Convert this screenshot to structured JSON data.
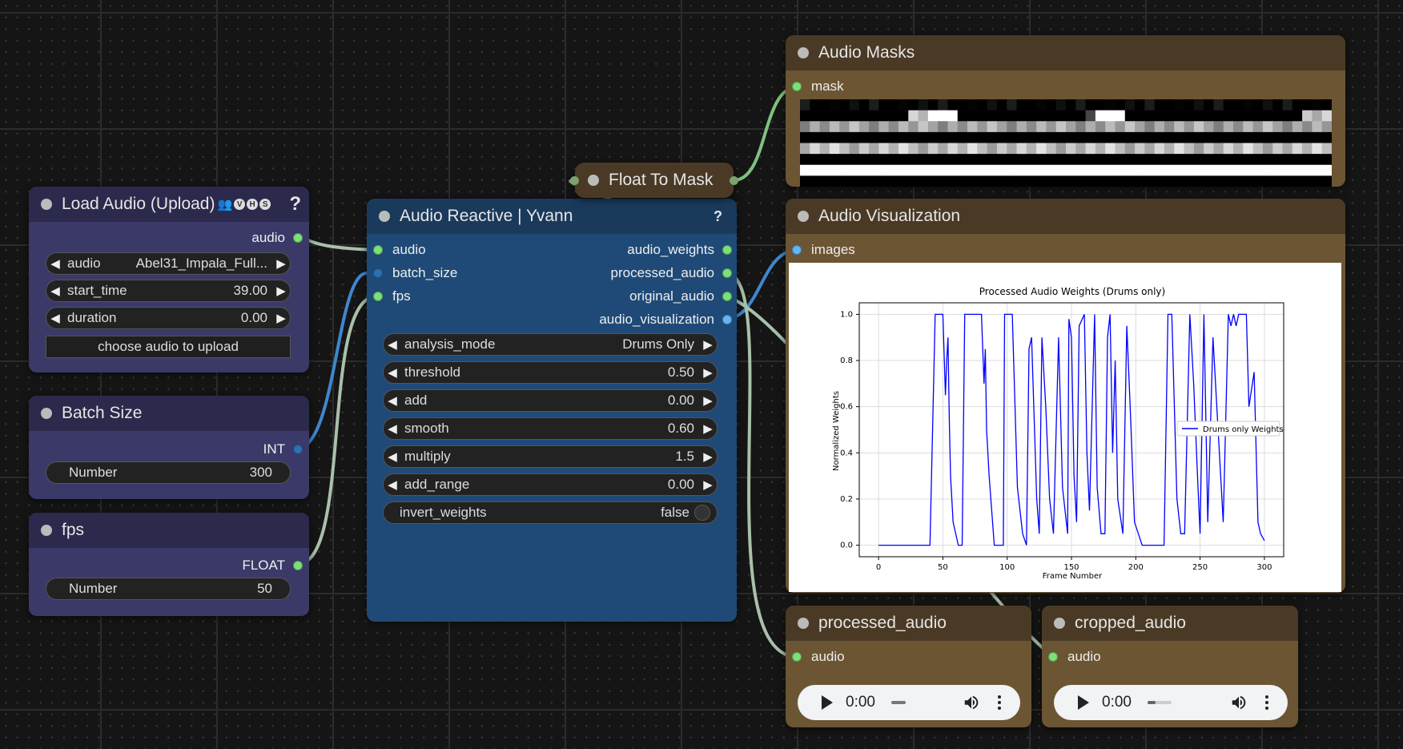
{
  "nodes": {
    "load_audio": {
      "title": "Load Audio (Upload)",
      "badges": [
        "V",
        "H",
        "S"
      ],
      "help": "?",
      "output": "audio",
      "widgets": {
        "audio": {
          "label": "audio",
          "value": "Abel31_Impala_Full..."
        },
        "start_time": {
          "label": "start_time",
          "value": "39.00"
        },
        "duration": {
          "label": "duration",
          "value": "0.00"
        }
      },
      "upload_button": "choose audio to upload"
    },
    "batch_size": {
      "title": "Batch Size",
      "output": "INT",
      "widget_label": "Number",
      "widget_value": "300"
    },
    "fps": {
      "title": "fps",
      "output": "FLOAT",
      "widget_label": "Number",
      "widget_value": "50"
    },
    "float_to_mask": {
      "title": "Float To Mask"
    },
    "audio_reactive": {
      "title": "Audio Reactive | Yvann",
      "help": "?",
      "inputs": [
        "audio",
        "batch_size",
        "fps"
      ],
      "outputs": [
        "audio_weights",
        "processed_audio",
        "original_audio",
        "audio_visualization"
      ],
      "widgets": [
        {
          "label": "analysis_mode",
          "value": "Drums Only"
        },
        {
          "label": "threshold",
          "value": "0.50"
        },
        {
          "label": "add",
          "value": "0.00"
        },
        {
          "label": "smooth",
          "value": "0.60"
        },
        {
          "label": "multiply",
          "value": "1.5"
        },
        {
          "label": "add_range",
          "value": "0.00"
        }
      ],
      "toggle": {
        "label": "invert_weights",
        "value": "false"
      }
    },
    "audio_masks": {
      "title": "Audio Masks",
      "input": "mask"
    },
    "audio_visualization": {
      "title": "Audio Visualization",
      "input": "images"
    },
    "processed_audio": {
      "title": "processed_audio",
      "input": "audio",
      "time": "0:00"
    },
    "cropped_audio": {
      "title": "cropped_audio",
      "input": "audio",
      "time": "0:00"
    }
  },
  "colors": {
    "purple_title": "#2b2a4c",
    "purple_body": "#3a3968",
    "blue_title": "#1a3a5c",
    "blue_body": "#1f4a77",
    "brown_title": "#4a3a25",
    "brown_body": "#6b5533",
    "link_gray": "#a9c0aa",
    "link_blue": "#3f87cf",
    "link_green": "#80c080",
    "plot_line": "#0000ff"
  },
  "mask_rows": [
    "111111111111111111111111111111111111111111111111111110",
    "000000000008899900000000000005999000000000000000000888",
    "777777777777777777777777777777777777777777777777777777",
    "000000000000000000000000000000000000000000000000000000",
    "888888888888888888888888888888888888888888888888888888",
    "000000000000000000000000000000000000000000000000000000",
    "999999999999999999999999999999999999999999999999999999",
    "000000000000000000000000000000000000000000000000000000"
  ],
  "chart_data": {
    "type": "line",
    "title": "Processed Audio Weights (Drums only)",
    "xlabel": "Frame Number",
    "ylabel": "Normalized Weights",
    "xlim": [
      -15,
      315
    ],
    "ylim": [
      -0.05,
      1.05
    ],
    "x_ticks": [
      0,
      50,
      100,
      150,
      200,
      250,
      300
    ],
    "y_ticks": [
      "0.0",
      "0.2",
      "0.4",
      "0.6",
      "0.8",
      "1.0"
    ],
    "grid": true,
    "legend_position": "right",
    "series": [
      {
        "name": "Drums only Weights",
        "x": [
          0,
          40,
          44,
          50,
          52,
          53,
          54,
          55,
          56,
          58,
          62,
          65,
          67,
          70,
          75,
          80,
          82,
          83,
          84,
          86,
          90,
          97,
          98,
          100,
          102,
          104,
          108,
          112,
          115,
          117,
          119,
          121,
          123,
          125,
          127,
          130,
          133,
          136,
          140,
          143,
          147,
          148,
          150,
          152,
          154,
          156,
          160,
          162,
          164,
          168,
          170,
          173,
          176,
          178,
          180,
          182,
          184,
          186,
          190,
          193,
          196,
          199,
          202,
          205,
          210,
          222,
          225,
          228,
          232,
          235,
          238,
          242,
          245,
          248,
          250,
          253,
          256,
          260,
          264,
          268,
          272,
          274,
          276,
          278,
          280,
          283,
          286,
          288,
          292,
          295,
          297,
          300
        ],
        "y": [
          0,
          0,
          1,
          1,
          0.65,
          0.8,
          0.9,
          0.55,
          0.3,
          0.1,
          0,
          0,
          1,
          1,
          1,
          1,
          0.7,
          0.85,
          0.5,
          0.3,
          0,
          0,
          1,
          1,
          1,
          1,
          0.25,
          0.05,
          0,
          0.85,
          0.9,
          0.55,
          0.2,
          0.05,
          0.9,
          0.6,
          0.2,
          0.05,
          0.9,
          0.25,
          0.05,
          0.98,
          0.9,
          0.3,
          0.1,
          0.95,
          1,
          0.4,
          0.15,
          1,
          0.25,
          0.05,
          0.05,
          0.9,
          1,
          0.4,
          0.8,
          0.2,
          0.05,
          0.95,
          0.55,
          0.1,
          0.05,
          0,
          0,
          0,
          1,
          1,
          0.2,
          0.05,
          0.05,
          1,
          0.7,
          0.3,
          0.05,
          1,
          0.1,
          0.9,
          0.5,
          0.1,
          1,
          0.95,
          1,
          0.95,
          1,
          1,
          1,
          0.6,
          0.75,
          0.1,
          0.05,
          0.02
        ]
      }
    ]
  }
}
